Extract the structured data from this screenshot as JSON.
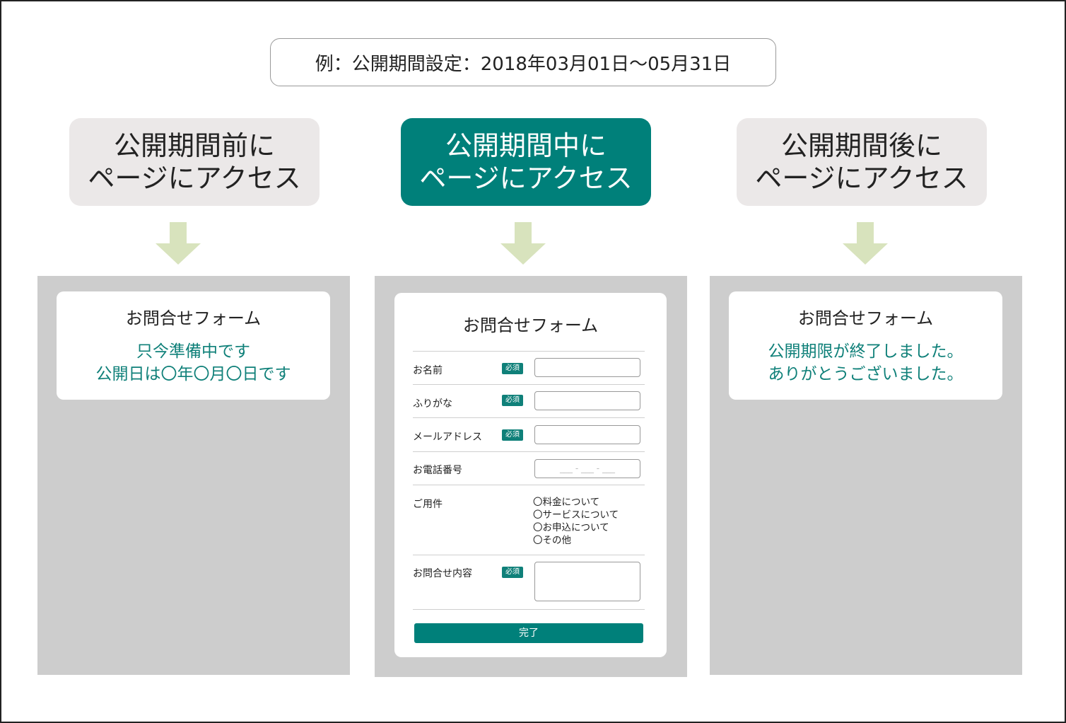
{
  "example_label": "例：公開期間設定：2018年03月01日〜05月31日",
  "columns": [
    {
      "header_line1": "公開期間前に",
      "header_line2": "ページにアクセス",
      "form_title": "お問合せフォーム",
      "message_line1": "只今準備中です",
      "message_line2": "公開日は〇年〇月〇日です"
    },
    {
      "header_line1": "公開期間中に",
      "header_line2": "ページにアクセス",
      "form_title": "お問合せフォーム"
    },
    {
      "header_line1": "公開期間後に",
      "header_line2": "ページにアクセス",
      "form_title": "お問合せフォーム",
      "message_line1": "公開期限が終了しました。",
      "message_line2": "ありがとうございました。"
    }
  ],
  "form": {
    "required_badge": "必須",
    "name_label": "お名前",
    "furigana_label": "ふりがな",
    "email_label": "メールアドレス",
    "phone_label": "お電話番号",
    "phone_placeholder": "___ - ___ - ___",
    "purpose_label": "ご用件",
    "options": [
      "〇料金について",
      "〇サービスについて",
      "〇お申込について",
      "〇その他"
    ],
    "message_label": "お問合せ内容",
    "submit_label": "完了"
  },
  "colors": {
    "accent": "#00807a",
    "header_gray": "#ebe8e8",
    "panel_gray": "#cdcdcd",
    "arrow_green": "#d8e3bd"
  }
}
